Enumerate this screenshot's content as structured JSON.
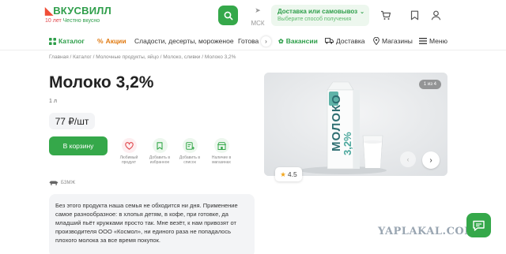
{
  "header": {
    "logo_main": "ВКУСВИЛЛ",
    "logo_years": "10 лет",
    "logo_tagline": "Честно вкусно",
    "city": "МСК",
    "delivery_title": "Доставка или самовывоз",
    "delivery_sub": "Выберите способ получения"
  },
  "nav": {
    "catalog": "Каталог",
    "promo": "Акции",
    "sweets": "Сладости, десерты, мороженое",
    "ready": "Готова",
    "vacancies": "Вакансии",
    "delivery": "Доставка",
    "stores": "Магазины",
    "menu": "Меню"
  },
  "breadcrumb": "Главная / Каталог / Молочные продукты, яйцо / Молоко, сливки / Молоко 3,2%",
  "product": {
    "title": "Молоко 3,2%",
    "volume": "1 л",
    "price": "77 ₽/шт",
    "cart_label": "В корзину",
    "badge": "БЗМЖ",
    "rating": "4.5",
    "description": "Без этого продукта наша семья не обходится ни дня. Применение самое разнообразное: в хлопья детям, в кофе, при готовке, да младший пьёт кружками просто так. Мне везёт, к нам привозят от производителя ООО «Космол», ни единого раза не попадалось плохого молока за все время покупок."
  },
  "actions": [
    {
      "label": "Любимый продукт",
      "icon": "heart-icon"
    },
    {
      "label": "Добавить в избранное",
      "icon": "bookmark-icon"
    },
    {
      "label": "Добавить в список",
      "icon": "list-add-icon"
    },
    {
      "label": "Наличие в магазинах",
      "icon": "store-icon"
    }
  ],
  "gallery": {
    "counter": "1 из 4",
    "carton_text": "МОЛОКО",
    "carton_fat": "3,2%"
  },
  "watermark": "YAPLAKAL.COM",
  "colors": {
    "brand_green": "#35a84a",
    "promo_orange": "#e07a12",
    "heart_pink": "#e0454a"
  }
}
